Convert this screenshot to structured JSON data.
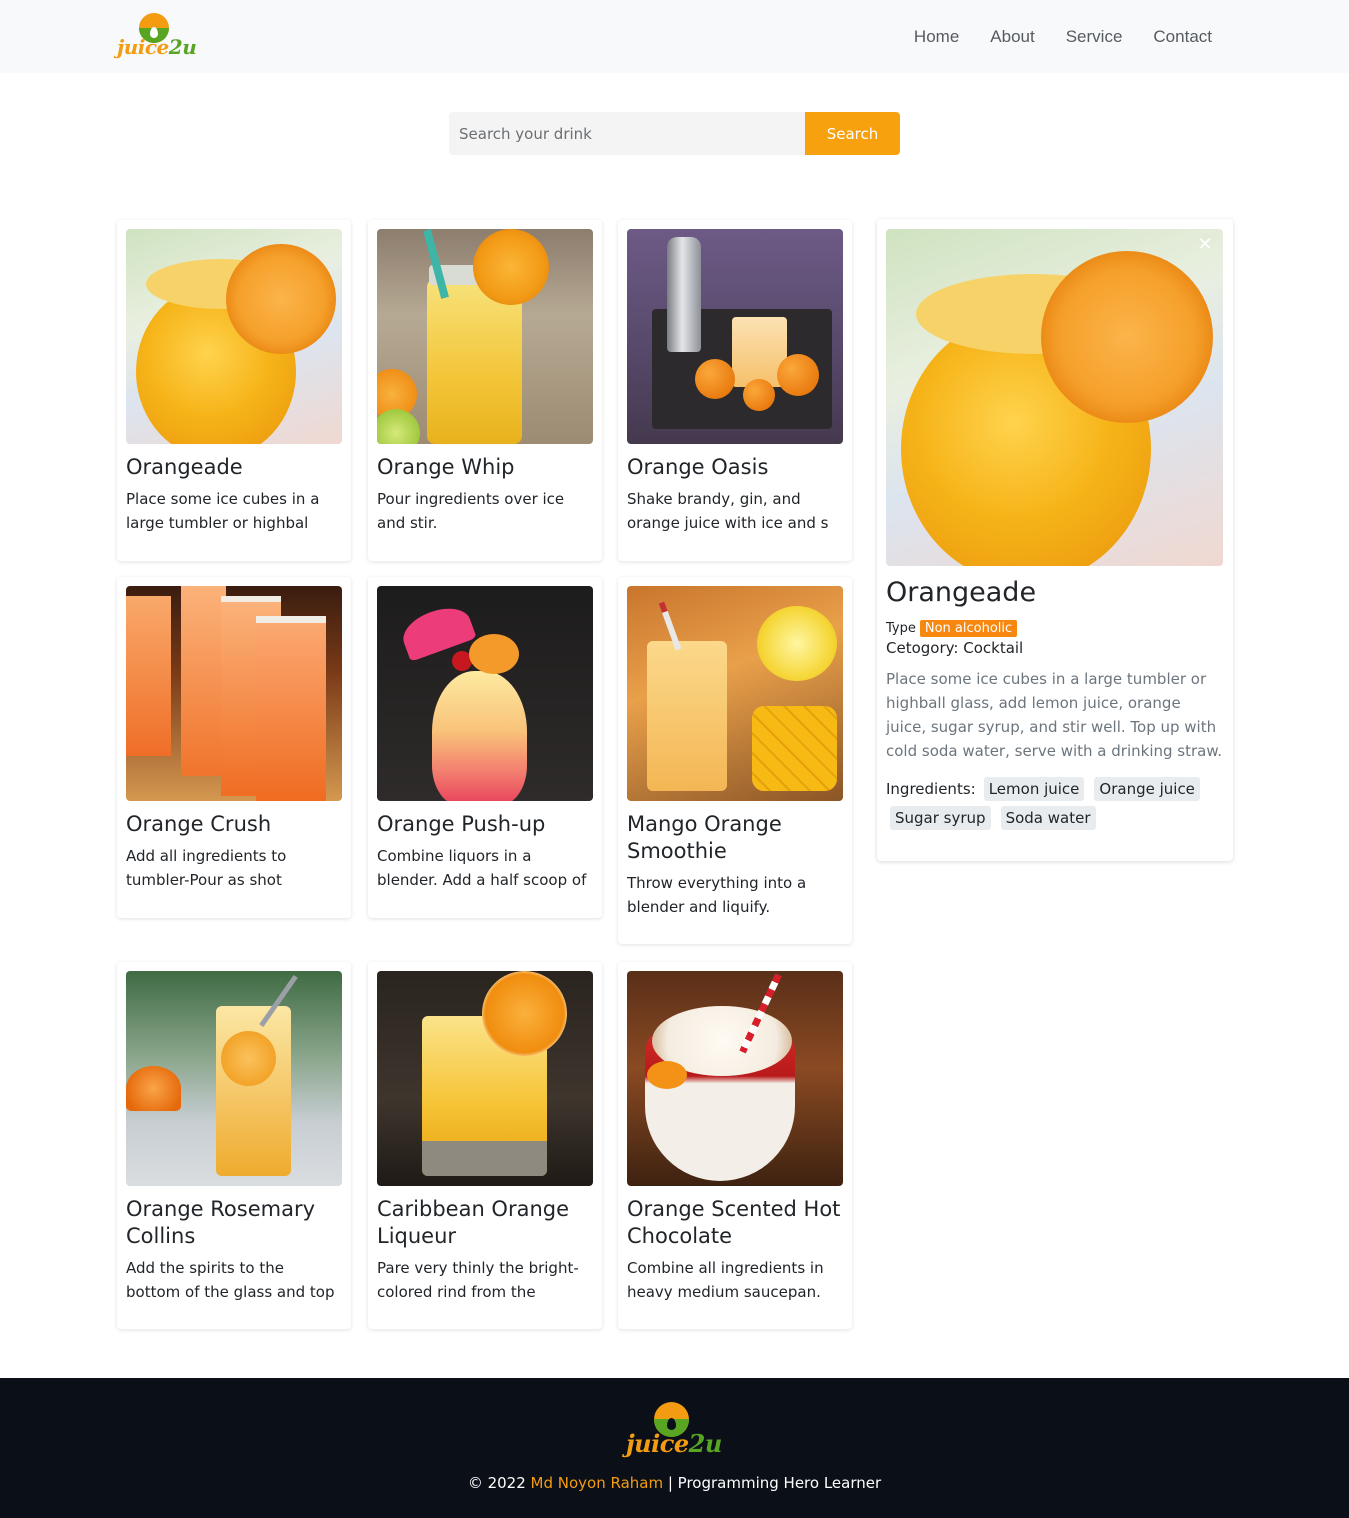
{
  "brand": {
    "logo_prefix": "juice",
    "logo_suffix": "2u"
  },
  "nav": {
    "items": [
      "Home",
      "About",
      "Service",
      "Contact"
    ]
  },
  "search": {
    "placeholder": "Search your drink",
    "value": "",
    "button_label": "Search"
  },
  "drinks": [
    {
      "name": "Orangeade",
      "text": "Place some ice cubes in a large tumbler or highbal",
      "image": "orangeade-photo"
    },
    {
      "name": "Orange Whip",
      "text": "Pour ingredients over ice and stir.",
      "image": "orange-whip-photo"
    },
    {
      "name": "Orange Oasis",
      "text": "Shake brandy, gin, and orange juice with ice and s",
      "image": "orange-oasis-photo"
    },
    {
      "name": "Orange Crush",
      "text": "Add all ingredients to tumbler-Pour as shot",
      "image": "orange-crush-photo"
    },
    {
      "name": "Orange Push-up",
      "text": "Combine liquors in a blender. Add a half scoop of",
      "image": "orange-push-up-photo"
    },
    {
      "name": "Mango Orange Smoothie",
      "text": "Throw everything into a blender and liquify.",
      "image": "mango-orange-smoothie-photo"
    },
    {
      "name": "Orange Rosemary Collins",
      "text": "Add the spirits to the bottom of the glass and top",
      "image": "orange-rosemary-collins-photo"
    },
    {
      "name": "Caribbean Orange Liqueur",
      "text": "Pare very thinly the bright-colored rind from the",
      "image": "caribbean-orange-liqueur-photo"
    },
    {
      "name": "Orange Scented Hot Chocolate",
      "text": "Combine all ingredients in heavy medium saucepan.",
      "image": "orange-scented-hot-chocolate-photo"
    }
  ],
  "detail": {
    "title": "Orangeade",
    "type_label": "Type",
    "type_value": "Non alcoholic",
    "category": "Cetogory: Cocktail",
    "description": "Place some ice cubes in a large tumbler or highball glass, add lemon juice, orange juice, sugar syrup, and stir well. Top up with cold soda water, serve with a drinking straw.",
    "ingredients_label": "Ingredients:",
    "ingredients": [
      "Lemon juice",
      "Orange juice",
      "Sugar syrup",
      "Soda water"
    ],
    "close_icon": "close-icon"
  },
  "footer": {
    "copyright_prefix": "© 2022 ",
    "author": "Md Noyon Raham",
    "copyright_suffix": " | Programming Hero Learner"
  },
  "colors": {
    "accent": "#f8a10e",
    "badge": "#f7870f",
    "footer_bg": "#0b0f17",
    "navbar_bg": "#f8f9fa",
    "logo_green": "#58a524"
  }
}
